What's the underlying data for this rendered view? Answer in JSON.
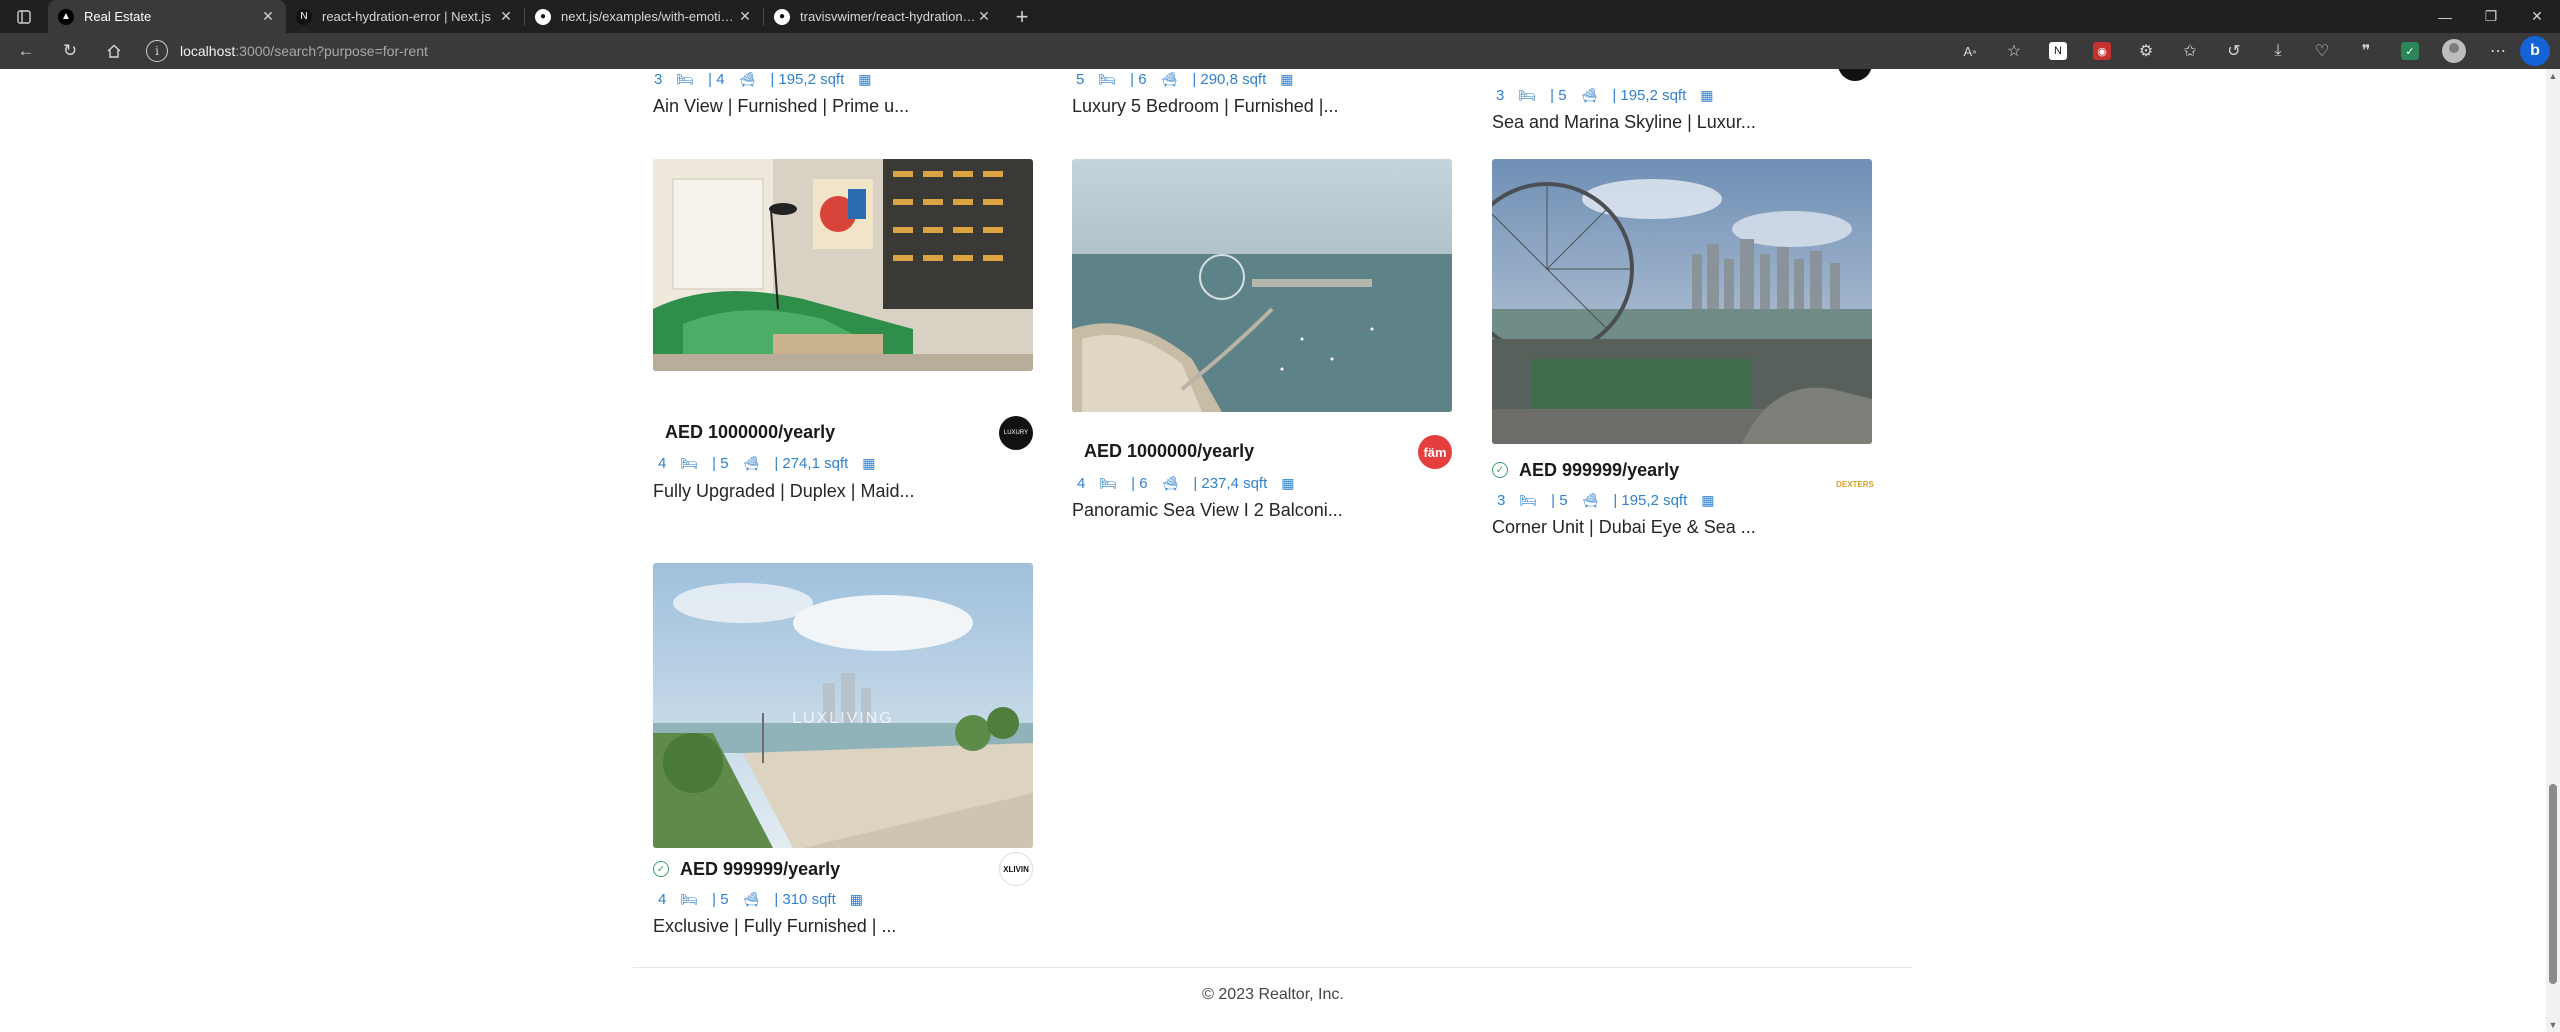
{
  "browser": {
    "tabs": [
      {
        "title": "Real Estate"
      },
      {
        "title": "react-hydration-error | Next.js"
      },
      {
        "title": "next.js/examples/with-emotion a..."
      },
      {
        "title": "travisvwimer/react-hydration-pro..."
      }
    ],
    "new_tab": "+",
    "address": {
      "host": "localhost",
      "path": ":3000/search?purpose=for-rent"
    }
  },
  "listings_top": [
    {
      "rooms": "3",
      "baths": "| 4",
      "area": "| 195,2 sqft",
      "title": "Ain View | Furnished | Prime u..."
    },
    {
      "rooms": "5",
      "baths": "| 6",
      "area": "| 290,8 sqft",
      "title": "Luxury 5 Bedroom | Furnished |..."
    },
    {
      "rooms": "3",
      "baths": "| 5",
      "area": "| 195,2 sqft",
      "title": "Sea and Marina Skyline | Luxur..."
    }
  ],
  "listings": [
    {
      "price": "AED 1000000/yearly",
      "verified": false,
      "rooms": "4",
      "baths": "| 5",
      "area": "| 274,1 sqft",
      "title": "Fully Upgraded | Duplex | Maid...",
      "agency": "LUXURY"
    },
    {
      "price": "AED 1000000/yearly",
      "verified": false,
      "rooms": "4",
      "baths": "| 6",
      "area": "| 237,4 sqft",
      "title": "Panoramic Sea View I 2 Balconi...",
      "agency": "fäm"
    },
    {
      "price": "AED 999999/yearly",
      "verified": true,
      "rooms": "3",
      "baths": "| 5",
      "area": "| 195,2 sqft",
      "title": "Corner Unit | Dubai Eye & Sea ...",
      "agency": "DEXTERS"
    },
    {
      "price": "AED 999999/yearly",
      "verified": true,
      "rooms": "4",
      "baths": "| 5",
      "area": "| 310 sqft",
      "title": "Exclusive | Fully Furnished | ...",
      "agency": "XLIVIN",
      "watermark": "LUXLIVING"
    }
  ],
  "footer": {
    "copyright": "© 2023 Realtor, Inc."
  },
  "colors": {
    "accent": "#3182ce",
    "verified": "#38a169",
    "fam": "#e53e3e"
  }
}
